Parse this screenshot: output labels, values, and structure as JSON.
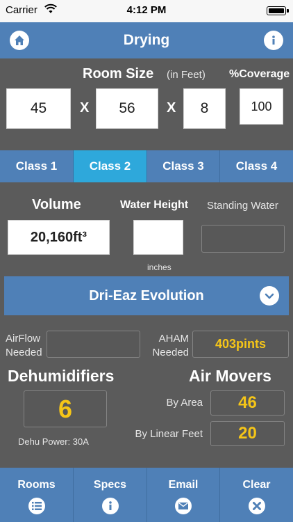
{
  "status_bar": {
    "carrier": "Carrier",
    "time": "4:12 PM"
  },
  "nav": {
    "title": "Drying",
    "home_icon": "home-icon",
    "info_icon": "info-icon"
  },
  "room_size": {
    "label": "Room Size",
    "unit": "(in Feet)",
    "coverage_label": "%Coverage",
    "length": "45",
    "width": "56",
    "height": "8",
    "times": "X",
    "coverage": "100"
  },
  "classes": {
    "items": [
      "Class 1",
      "Class 2",
      "Class 3",
      "Class 4"
    ],
    "selected": "Class 2"
  },
  "volume": {
    "label": "Volume",
    "value": "20,160ft³"
  },
  "water_height": {
    "label": "Water Height",
    "value": "",
    "unit": "inches"
  },
  "standing_water": {
    "label": "Standing Water",
    "value": ""
  },
  "dehumidifier_model": {
    "selected": "Dri-Eaz Evolution"
  },
  "airflow": {
    "label_line1": "AirFlow",
    "label_line2": "Needed",
    "value": ""
  },
  "aham": {
    "label_line1": "AHAM",
    "label_line2": "Needed",
    "value": "403pints"
  },
  "dehumidifiers": {
    "label": "Dehumidifiers",
    "count": "6",
    "power_note": "Dehu Power: 30A"
  },
  "air_movers": {
    "label": "Air Movers",
    "by_area_label": "By Area",
    "by_area_value": "46",
    "by_linear_label": "By Linear Feet",
    "by_linear_value": "20"
  },
  "tabs": [
    "Rooms",
    "Specs",
    "Email",
    "Clear"
  ],
  "colors": {
    "accent_blue": "#4f80b7",
    "active_blue": "#2ea8db",
    "background": "#5b5b5b",
    "highlight_yellow": "#f5c518"
  }
}
